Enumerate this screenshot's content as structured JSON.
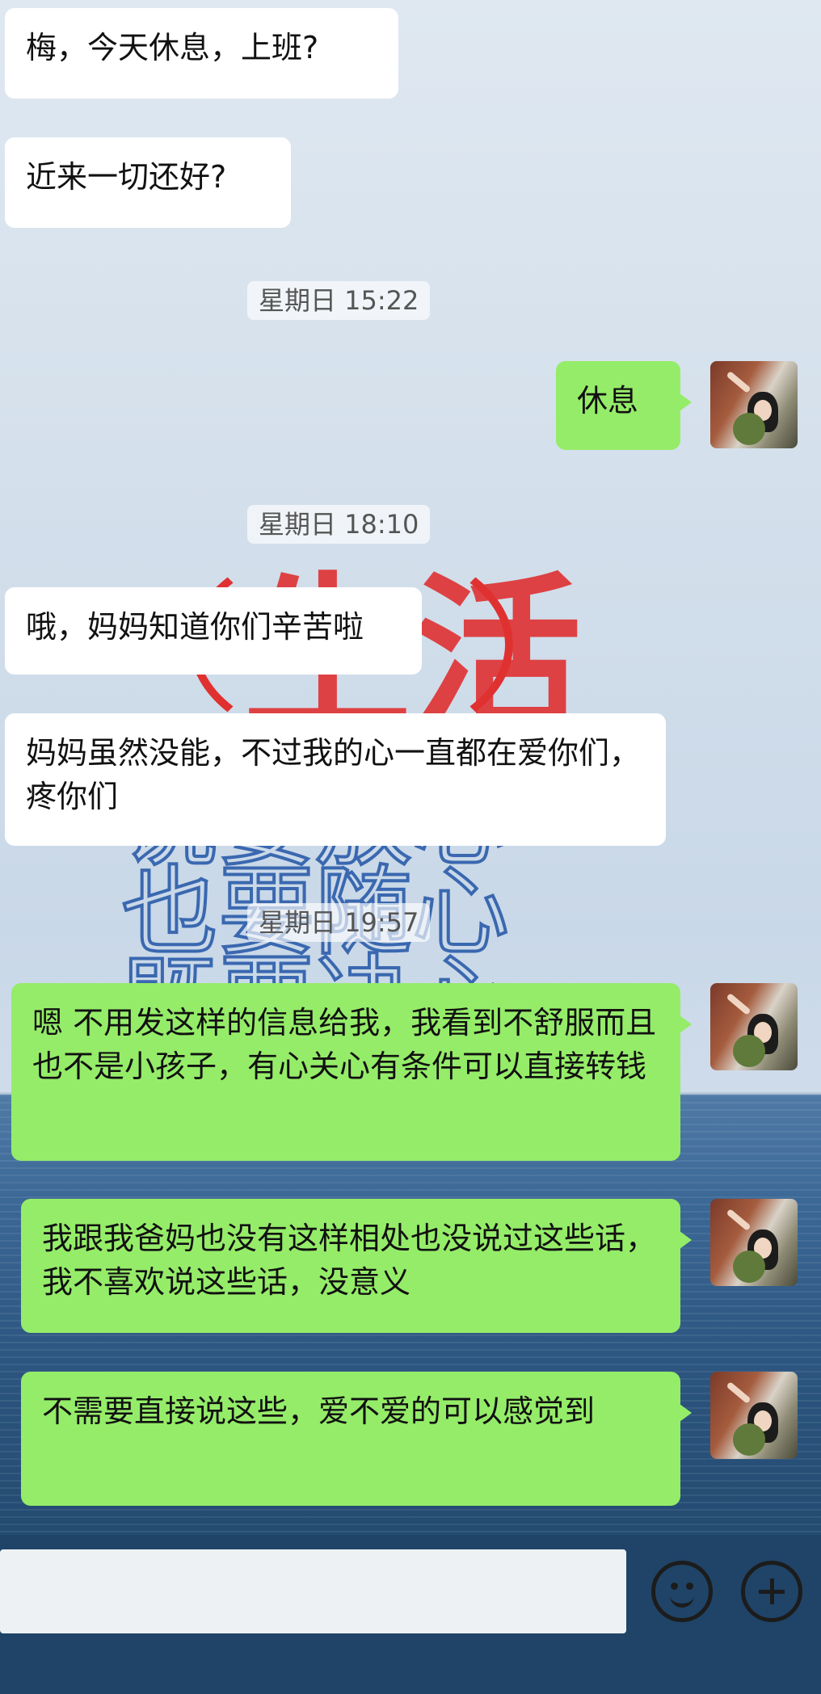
{
  "messages": [
    {
      "side": "left",
      "text": "梅，今天休息，上班?"
    },
    {
      "side": "left",
      "text": "近来一切还好?"
    },
    {
      "side": "right",
      "text": "休息"
    },
    {
      "side": "left",
      "text": "哦，妈妈知道你们辛苦啦"
    },
    {
      "side": "left",
      "text": "妈妈虽然没能，不过我的心一直都在爱你们，疼你们"
    },
    {
      "side": "right",
      "text": "嗯 不用发这样的信息给我，我看到不舒服而且也不是小孩子，有心关心有条件可以直接转钱"
    },
    {
      "side": "right",
      "text": "我跟我爸妈也没有这样相处也没说过这些话，我不喜欢说这些话，没意义"
    },
    {
      "side": "right",
      "text": "不需要直接说这些，爱不爱的可以感觉到"
    }
  ],
  "timestamps": [
    "星期日 15:22",
    "星期日 18:10",
    "星期日 19:57"
  ],
  "wallpaper": {
    "stamp_text": "生活",
    "lines": [
      "说要放心",
      "也要随心",
      "既要决心"
    ],
    "stamp_color": "#e03131",
    "text_color": "#3a68b0"
  },
  "colors": {
    "sent_bubble": "#95ec69",
    "received_bubble": "#ffffff"
  },
  "toolbar": {
    "emoji_icon": "smiley-face-icon",
    "add_icon": "plus-circle-icon"
  }
}
